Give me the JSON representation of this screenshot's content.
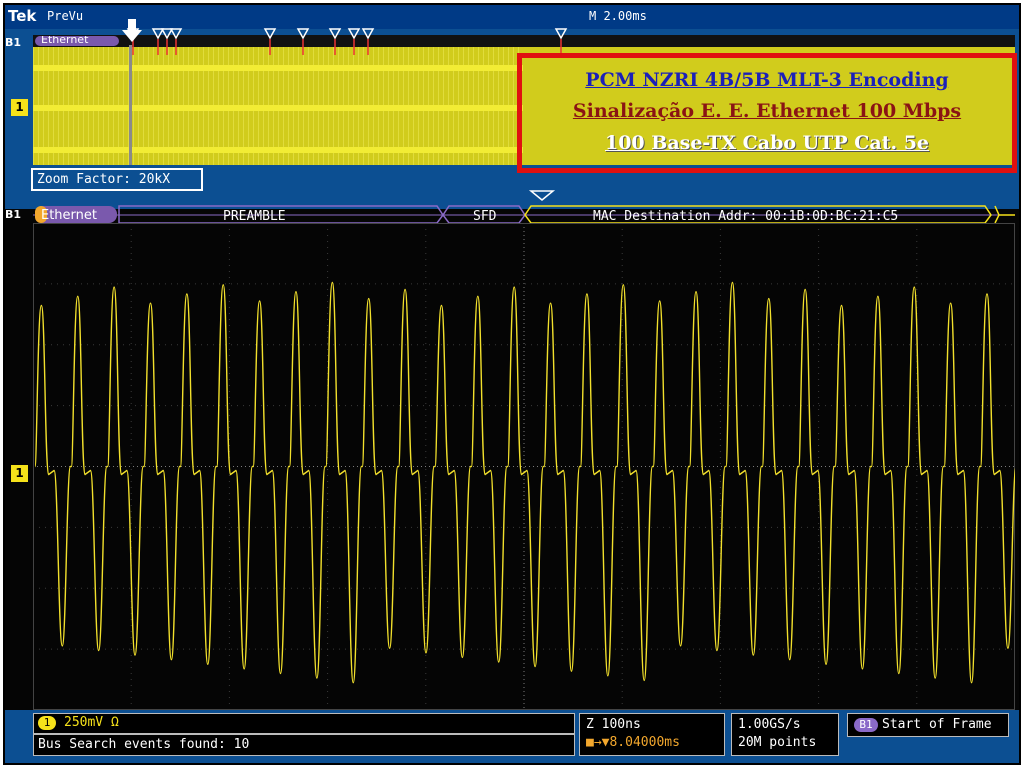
{
  "header": {
    "brand": "Tek",
    "mode": "PreVu",
    "horizontal_position": "M 2.00ms"
  },
  "overview": {
    "bus_label": "Ethernet",
    "zoom_factor": "Zoom Factor: 20kX",
    "channel_marker": "1",
    "bus_marker": "B1"
  },
  "title_box": {
    "line1": "PCM NZRI 4B/5B  MLT-3 Encoding",
    "line2": "Sinalização E. E. Ethernet 100 Mbps",
    "line3": "100 Base-TX  Cabo UTP Cat. 5e"
  },
  "bus_decode": {
    "bus_marker": "B1",
    "bus_label": "Ethernet",
    "fields": [
      "PREAMBLE",
      "SFD",
      "MAC Destination Addr: 00:1B:0D:BC:21:C5"
    ]
  },
  "waveform": {
    "channel_marker": "1",
    "trace_color": "#f2e02c"
  },
  "status": {
    "channel_chip": "1",
    "channel_scale": "250mV",
    "impedance": "Ω",
    "search_results": "Bus Search events found: 10",
    "zoom_timebase": "Z 100ns",
    "trigger_position": "8.04000ms",
    "sample_rate": "1.00GS/s",
    "record_length": "20M points",
    "trigger_source": "B1",
    "trigger_type": "Start of Frame"
  },
  "colors": {
    "background": "#050505",
    "frame_blue": "#0c4f92",
    "channel1": "#f6e21a",
    "bus": "#8a6ac8",
    "title_border": "#e01010"
  }
}
